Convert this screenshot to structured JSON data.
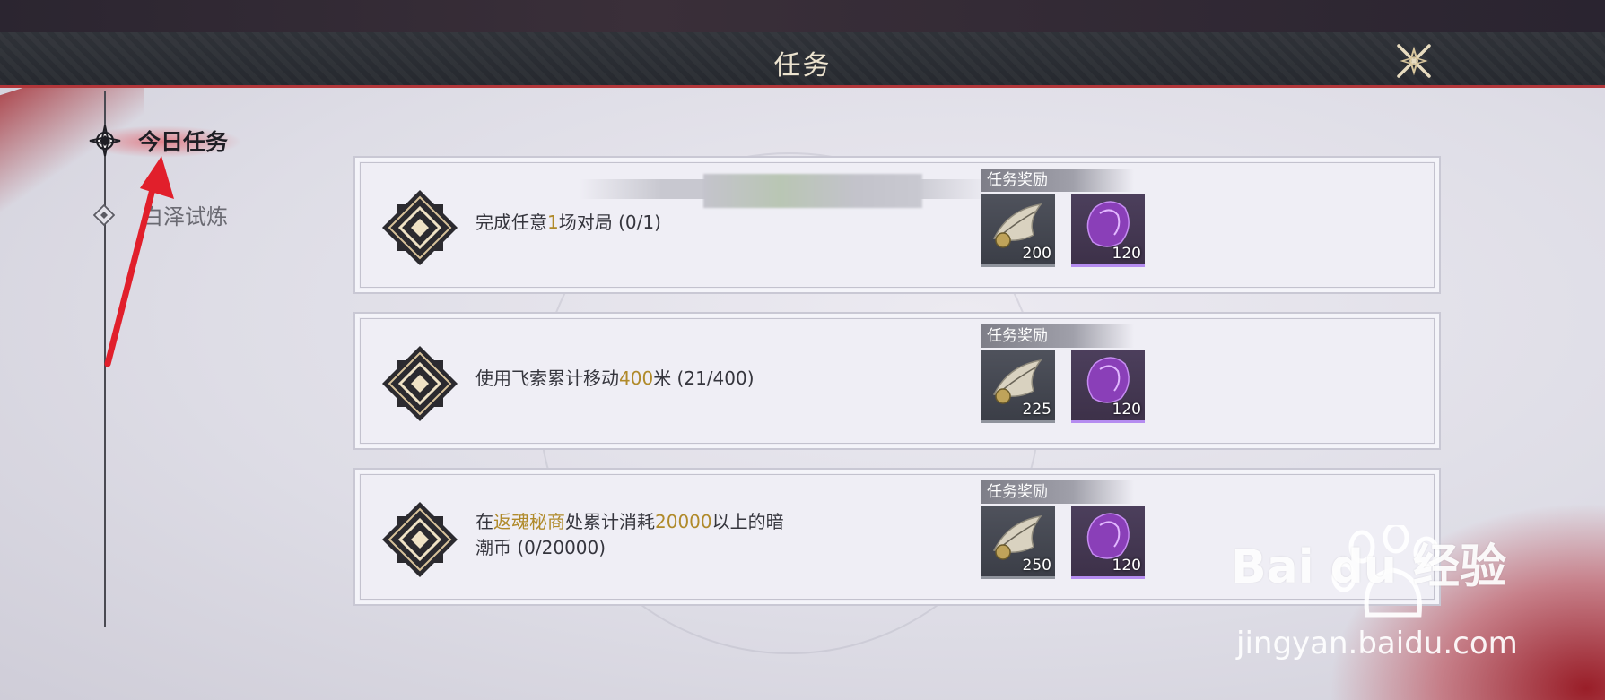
{
  "header": {
    "title": "任务"
  },
  "nav": {
    "items": [
      {
        "label": "今日任务",
        "active": true
      },
      {
        "label": "白泽试炼",
        "active": false
      }
    ]
  },
  "quests": [
    {
      "text_parts": [
        "完成任意",
        "1",
        "场对局 (0/1)"
      ],
      "reward_label": "任务奖励",
      "rewards": [
        {
          "icon": "feather-token-icon",
          "count": "200"
        },
        {
          "icon": "purple-crystal-icon",
          "count": "120"
        }
      ]
    },
    {
      "text_parts": [
        "使用飞索累计移动",
        "400",
        "米 (21/400)"
      ],
      "reward_label": "任务奖励",
      "rewards": [
        {
          "icon": "feather-token-icon",
          "count": "225"
        },
        {
          "icon": "purple-crystal-icon",
          "count": "120"
        }
      ]
    },
    {
      "text_parts": [
        "在",
        "返魂秘商",
        "处累计消耗",
        "20000",
        "以上的暗",
        "潮币 (0/20000)"
      ],
      "reward_label": "任务奖励",
      "rewards": [
        {
          "icon": "feather-token-icon",
          "count": "250"
        },
        {
          "icon": "purple-crystal-icon",
          "count": "120"
        }
      ]
    }
  ],
  "watermark": {
    "brand": "Bai du 经验",
    "url": "jingyan.baidu.com"
  },
  "colors": {
    "accent_red": "#b3363a",
    "highlight_gold": "#b08a2a",
    "rare_purple": "#b58cf0"
  }
}
